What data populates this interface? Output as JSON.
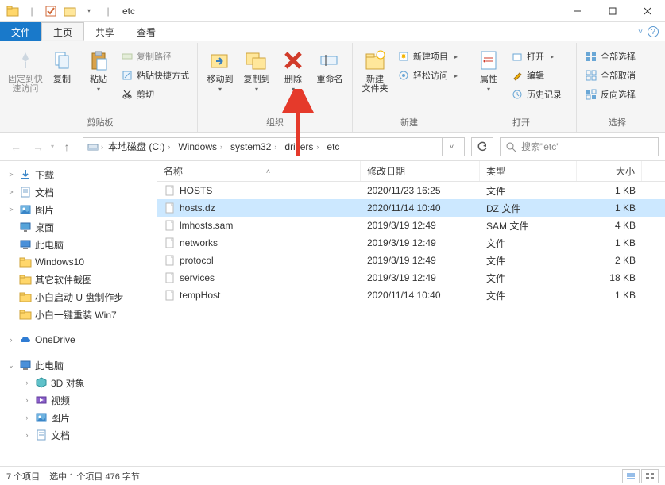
{
  "window": {
    "title": "etc"
  },
  "tabs": {
    "file": "文件",
    "home": "主页",
    "share": "共享",
    "view": "查看"
  },
  "ribbon": {
    "pin": {
      "label": "固定到快\n速访问"
    },
    "copy": {
      "label": "复制"
    },
    "paste": {
      "label": "粘贴"
    },
    "copy_path": "复制路径",
    "paste_shortcut": "粘贴快捷方式",
    "cut": "剪切",
    "group_clipboard": "剪贴板",
    "move_to": "移动到",
    "copy_to": "复制到",
    "delete": "删除",
    "rename": "重命名",
    "group_organize": "组织",
    "new_folder": "新建\n文件夹",
    "new_item": "新建项目",
    "easy_access": "轻松访问",
    "group_new": "新建",
    "properties": "属性",
    "open": "打开",
    "edit": "编辑",
    "history": "历史记录",
    "group_open": "打开",
    "select_all": "全部选择",
    "select_none": "全部取消",
    "invert_selection": "反向选择",
    "group_select": "选择"
  },
  "breadcrumbs": [
    "本地磁盘 (C:)",
    "Windows",
    "system32",
    "drivers",
    "etc"
  ],
  "search": {
    "placeholder": "搜索\"etc\""
  },
  "sidebar": {
    "items": [
      {
        "label": "下载",
        "icon": "downloads",
        "exp": ">"
      },
      {
        "label": "文档",
        "icon": "document",
        "exp": ">"
      },
      {
        "label": "图片",
        "icon": "picture",
        "exp": ">"
      },
      {
        "label": "桌面",
        "icon": "desktop",
        "exp": ""
      },
      {
        "label": "此电脑",
        "icon": "pc",
        "exp": ""
      },
      {
        "label": "Windows10",
        "icon": "folder",
        "exp": ""
      },
      {
        "label": "其它软件截图",
        "icon": "folder",
        "exp": ""
      },
      {
        "label": "小白启动 U 盘制作步",
        "icon": "folder",
        "exp": ""
      },
      {
        "label": "小白一键重装 Win7 ",
        "icon": "folder",
        "exp": ""
      }
    ],
    "onedrive": "OneDrive",
    "thispc": "此电脑",
    "thispc_children": [
      {
        "label": "3D 对象",
        "icon": "3d"
      },
      {
        "label": "视频",
        "icon": "video"
      },
      {
        "label": "图片",
        "icon": "picture"
      },
      {
        "label": "文档",
        "icon": "document"
      }
    ]
  },
  "columns": {
    "name": "名称",
    "date": "修改日期",
    "type": "类型",
    "size": "大小"
  },
  "files": [
    {
      "name": "HOSTS",
      "date": "2020/11/23 16:25",
      "type": "文件",
      "size": "1 KB",
      "selected": false
    },
    {
      "name": "hosts.dz",
      "date": "2020/11/14 10:40",
      "type": "DZ 文件",
      "size": "1 KB",
      "selected": true
    },
    {
      "name": "lmhosts.sam",
      "date": "2019/3/19 12:49",
      "type": "SAM 文件",
      "size": "4 KB",
      "selected": false
    },
    {
      "name": "networks",
      "date": "2019/3/19 12:49",
      "type": "文件",
      "size": "1 KB",
      "selected": false
    },
    {
      "name": "protocol",
      "date": "2019/3/19 12:49",
      "type": "文件",
      "size": "2 KB",
      "selected": false
    },
    {
      "name": "services",
      "date": "2019/3/19 12:49",
      "type": "文件",
      "size": "18 KB",
      "selected": false
    },
    {
      "name": "tempHost",
      "date": "2020/11/14 10:40",
      "type": "文件",
      "size": "1 KB",
      "selected": false
    }
  ],
  "status": {
    "count": "7 个项目",
    "selection": "选中 1 个项目  476 字节"
  }
}
